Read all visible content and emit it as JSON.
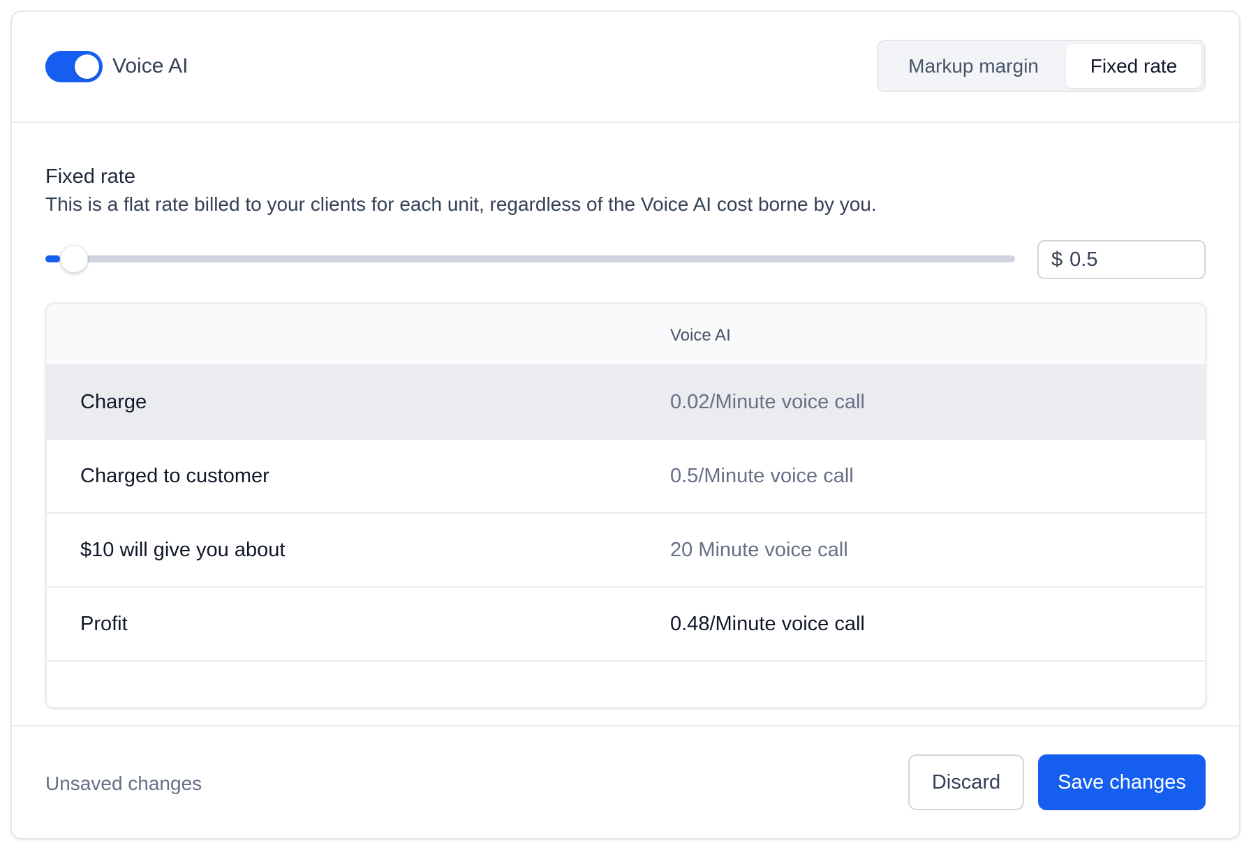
{
  "header": {
    "toggle_label": "Voice AI",
    "toggle_on": true,
    "tabs": [
      {
        "label": "Markup margin",
        "selected": false
      },
      {
        "label": "Fixed rate",
        "selected": true
      }
    ]
  },
  "fixed_rate": {
    "title": "Fixed rate",
    "description": "This is a flat rate billed to your clients for each unit, regardless of the Voice AI cost borne by you.",
    "slider_fraction": 0.015,
    "currency": "$",
    "value": "0.5"
  },
  "table": {
    "header": [
      "",
      "Voice AI"
    ],
    "rows": [
      {
        "label": "Charge",
        "value": "0.02/Minute voice call"
      },
      {
        "label": "Charged to customer",
        "value": "0.5/Minute voice call"
      },
      {
        "label": "$10 will give you about",
        "value": "20 Minute voice call"
      },
      {
        "label": "Profit",
        "value": "0.48/Minute voice call"
      }
    ]
  },
  "footer": {
    "status": "Unsaved changes",
    "discard_label": "Discard",
    "save_label": "Save changes"
  },
  "colors": {
    "accent": "#155eef",
    "border": "#eaecf0",
    "muted_text": "#667085"
  }
}
